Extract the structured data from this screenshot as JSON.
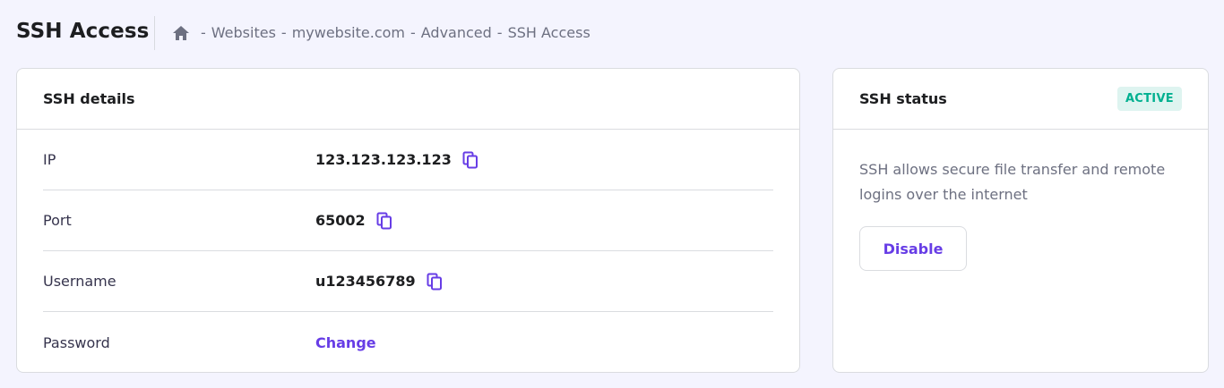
{
  "header": {
    "title": "SSH Access",
    "breadcrumb": {
      "home_icon": "home-icon",
      "separator": "-",
      "items": [
        "Websites",
        "mywebsite.com",
        "Advanced",
        "SSH Access"
      ]
    }
  },
  "details": {
    "title": "SSH details",
    "rows": [
      {
        "label": "IP",
        "value": "123.123.123.123",
        "copy": true
      },
      {
        "label": "Port",
        "value": "65002",
        "copy": true
      },
      {
        "label": "Username",
        "value": "u123456789",
        "copy": true
      },
      {
        "label": "Password",
        "link": "Change"
      }
    ]
  },
  "status": {
    "title": "SSH status",
    "badge": "ACTIVE",
    "description": "SSH allows secure file transfer and remote logins over the internet",
    "button_label": "Disable"
  },
  "colors": {
    "accent": "#673de6",
    "badge_bg": "#def4f0",
    "badge_text": "#00b090",
    "background": "#f4f4fe"
  }
}
